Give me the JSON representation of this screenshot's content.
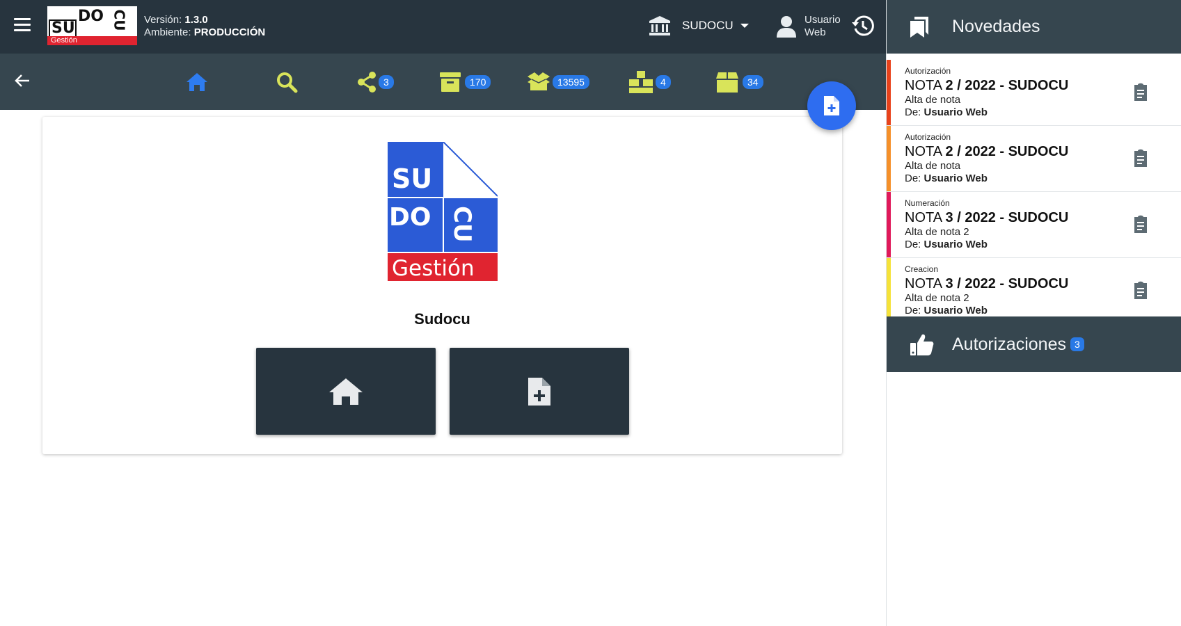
{
  "header": {
    "logo": {
      "su": "SU",
      "do": "DO",
      "cu": "CU",
      "gestion": "Gestión"
    },
    "version_label": "Versión:",
    "version_value": "1.3.0",
    "env_label": "Ambiente:",
    "env_value": "PRODUCCIÓN",
    "entity": "SUDOCU",
    "user_line1": "Usuario",
    "user_line2": "Web"
  },
  "nav": {
    "items": [
      {
        "icon": "home-icon",
        "color": "#2e7cf0",
        "badge": ""
      },
      {
        "icon": "search-icon",
        "color": "#d9e45a",
        "badge": ""
      },
      {
        "icon": "share-icon",
        "color": "#d9e45a",
        "badge": "3"
      },
      {
        "icon": "archive-icon",
        "color": "#d9e45a",
        "badge": "170"
      },
      {
        "icon": "open-box-icon",
        "color": "#d9e45a",
        "badge": "13595"
      },
      {
        "icon": "boxes-icon",
        "color": "#d9e45a",
        "badge": "4"
      },
      {
        "icon": "box-icon",
        "color": "#d9e45a",
        "badge": "34"
      }
    ]
  },
  "main": {
    "logo_text": {
      "su": "SU",
      "do": "DO",
      "cu": "CU",
      "gestion": "Gestión"
    },
    "site_name": "Sudocu"
  },
  "news_panel": {
    "title": "Novedades",
    "items": [
      {
        "kind": "Autorización",
        "title_prefix": "NOTA ",
        "title_bold": "2 / 2022 - SUDOCU",
        "desc": "Alta de nota",
        "from_label": "De: ",
        "from_user": "Usuario Web",
        "color": "#e8421b"
      },
      {
        "kind": "Autorización",
        "title_prefix": "NOTA ",
        "title_bold": "2 / 2022 - SUDOCU",
        "desc": "Alta de nota",
        "from_label": "De: ",
        "from_user": "Usuario Web",
        "color": "#f5902a"
      },
      {
        "kind": "Numeración",
        "title_prefix": "NOTA ",
        "title_bold": "3 / 2022 - SUDOCU",
        "desc": "Alta de nota 2",
        "from_label": "De: ",
        "from_user": "Usuario Web",
        "color": "#e0195a"
      },
      {
        "kind": "Creacion",
        "title_prefix": "NOTA ",
        "title_bold": "3 / 2022 - SUDOCU",
        "desc": "Alta de nota 2",
        "from_label": "De: ",
        "from_user": "Usuario Web",
        "color": "#f5e23a"
      }
    ]
  },
  "auth_panel": {
    "title": "Autorizaciones",
    "badge": "3"
  },
  "colors": {
    "header": "#27343e",
    "navbar": "#36464f",
    "accent": "#2e6df0",
    "icon_yellow": "#d9e45a",
    "brand_blue": "#2b5bd6",
    "brand_red": "#e02430"
  }
}
